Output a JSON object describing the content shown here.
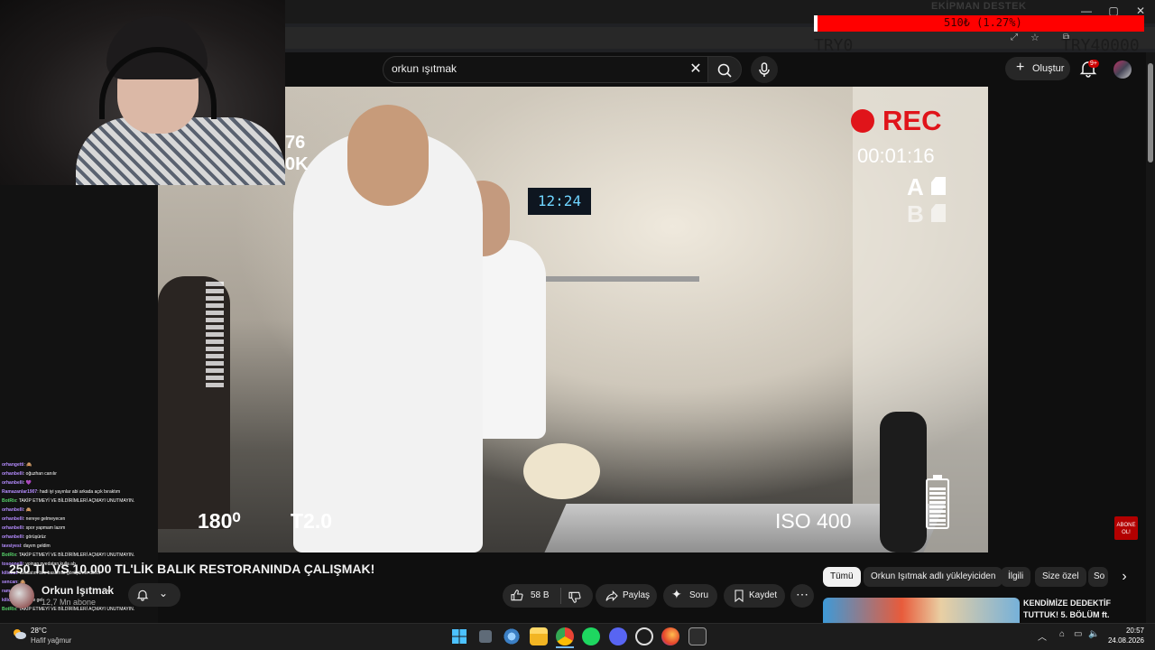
{
  "donation": {
    "title": "EKİPMAN DESTEK",
    "progress_text": "510₺ (1.27%)",
    "progress": 0.0127,
    "start_label": "TRY0",
    "goal_label": "TRY40000"
  },
  "search": {
    "query": "orkun ışıtmak"
  },
  "header": {
    "create_label": "Oluştur",
    "notif_badge": "9+"
  },
  "video_overlay": {
    "rec_label": "REC",
    "rec_time": "00:01:16",
    "slot_a": "A",
    "slot_b": "B",
    "shutter": "180⁰",
    "aperture": "T2.0",
    "iso": "ISO 400",
    "clock": "12:24",
    "partial_text": [
      "76",
      "0K"
    ],
    "sub_badge": "ABONE OL!"
  },
  "video": {
    "title": "250 TL VS 10.000 TL'LİK BALIK RESTORANINDA ÇALIŞMAK!",
    "channel": "Orkun Işıtmak",
    "subscribers": "12,7 Mn abone",
    "likes": "58 B",
    "share_label": "Paylaş",
    "ask_label": "Soru",
    "save_label": "Kaydet"
  },
  "chips": [
    "Tümü",
    "Orkun Işıtmak adlı yükleyiciden",
    "İlgili",
    "Size özel",
    "So"
  ],
  "recommended": {
    "title": "KENDİMİZE DEDEKTİF TUTTUK! 5. BÖLÜM ft."
  },
  "chat": [
    {
      "user": "orhangetti",
      "msg": ": 🙈"
    },
    {
      "user": "orhanbelli",
      "msg": ": oğuzhan canılır"
    },
    {
      "user": "orhanbelli",
      "msg": ": 💜"
    },
    {
      "user": "Ramazanlar1907",
      "msg": ": hadi iyi yayınlar abi arkada açık bıraktım"
    },
    {
      "user": "BotRix",
      "msg": ": TAKİP ETMEYİ VE BİLDİRİMLERİ AÇMAYI UNUTMAYIN.",
      "bot": true
    },
    {
      "user": "orhanbelli",
      "msg": ": 🙈"
    },
    {
      "user": "orhanbelli",
      "msg": ": nereye gelmeyecen"
    },
    {
      "user": "orhanbelli",
      "msg": ": spor yapmam lazım"
    },
    {
      "user": "orhanbelli",
      "msg": ": görüşürüz"
    },
    {
      "user": "tavsiyesi",
      "msg": ": dayım geldim"
    },
    {
      "user": "BotRix",
      "msg": ": TAKİP ETMEYİ VE BİLDİRİMLERİ AÇMAYI UNUTMAYIN.",
      "bot": true
    },
    {
      "user": "tosoonelli",
      "msg": ": yoinan pvedatan kulla ab"
    },
    {
      "user": "kilickul",
      "msg": ": avukatım bile basamile görüşürme dileöi"
    },
    {
      "user": "sencan",
      "msg": ": 🙈"
    },
    {
      "user": "ramsa",
      "msg": ": yetar"
    },
    {
      "user": "kilickul",
      "msg": ": kendine gel"
    },
    {
      "user": "BotRix",
      "msg": ": TAKİP ETMEYİ VE BİLDİRİMLERİ AÇMAYI UNUTMAYIN.",
      "bot": true
    }
  ],
  "taskbar": {
    "weather_temp": "28°C",
    "weather_desc": "Hafif yağmur",
    "time": "20:57",
    "date": "24.08.2026"
  }
}
